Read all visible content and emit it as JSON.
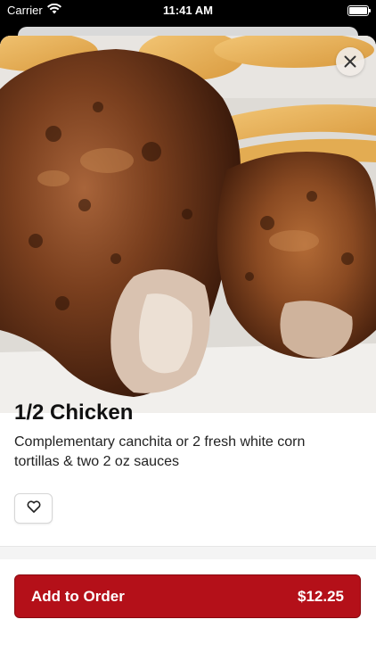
{
  "status": {
    "carrier": "Carrier",
    "time": "11:41 AM"
  },
  "item": {
    "name": "1/2 Chicken",
    "description": "Complementary canchita or 2 fresh white corn tortillas & two 2 oz sauces"
  },
  "order": {
    "label": "Add to Order",
    "price": "$12.25"
  },
  "icons": {
    "close": "close-icon",
    "favorite": "heart-icon",
    "wifi": "wifi-icon",
    "battery": "battery-icon"
  },
  "colors": {
    "accent": "#b41019"
  }
}
